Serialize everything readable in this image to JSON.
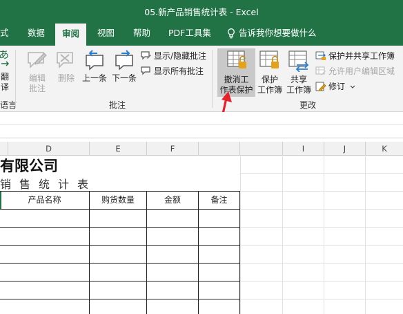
{
  "app": {
    "title": "05.新产品销售统计表 - Excel"
  },
  "tabs": [
    {
      "label": "式",
      "active": false
    },
    {
      "label": "数据",
      "active": false
    },
    {
      "label": "审阅",
      "active": true
    },
    {
      "label": "视图",
      "active": false
    },
    {
      "label": "帮助",
      "active": false
    },
    {
      "label": "PDF工具集",
      "active": false
    }
  ],
  "tell_me": "告诉我你想要做什么",
  "ribbon": {
    "translate": {
      "line1": "翻",
      "line2": "译"
    },
    "language_group": "语言",
    "comments": {
      "edit": {
        "line1": "编辑",
        "line2": "批注"
      },
      "delete": "删除",
      "previous": "上一条",
      "next": "下一条",
      "show_hide": "显示/隐藏批注",
      "show_all": "显示所有批注",
      "group_label": "批注"
    },
    "changes": {
      "unprotect_sheet": {
        "line1": "撤消工",
        "line2": "作表保护"
      },
      "protect_workbook": {
        "line1": "保护",
        "line2": "工作簿"
      },
      "share_workbook": {
        "line1": "共享",
        "line2": "工作簿"
      },
      "protect_and_share": "保护并共享工作簿",
      "allow_edit_ranges": "允许用户编辑区域",
      "track_changes": "修订",
      "group_label": "更改"
    }
  },
  "columns": [
    "D",
    "E",
    "F",
    "I",
    "J",
    "K"
  ],
  "sheet": {
    "title": "有限公司",
    "subtitle": "销售统计表",
    "headers": [
      "产品名称",
      "购货数量",
      "金额",
      "备注"
    ]
  },
  "colors": {
    "brand_green": "#217346",
    "ribbon_bg": "#f3f3f3",
    "arrow_red": "#e8202a"
  }
}
